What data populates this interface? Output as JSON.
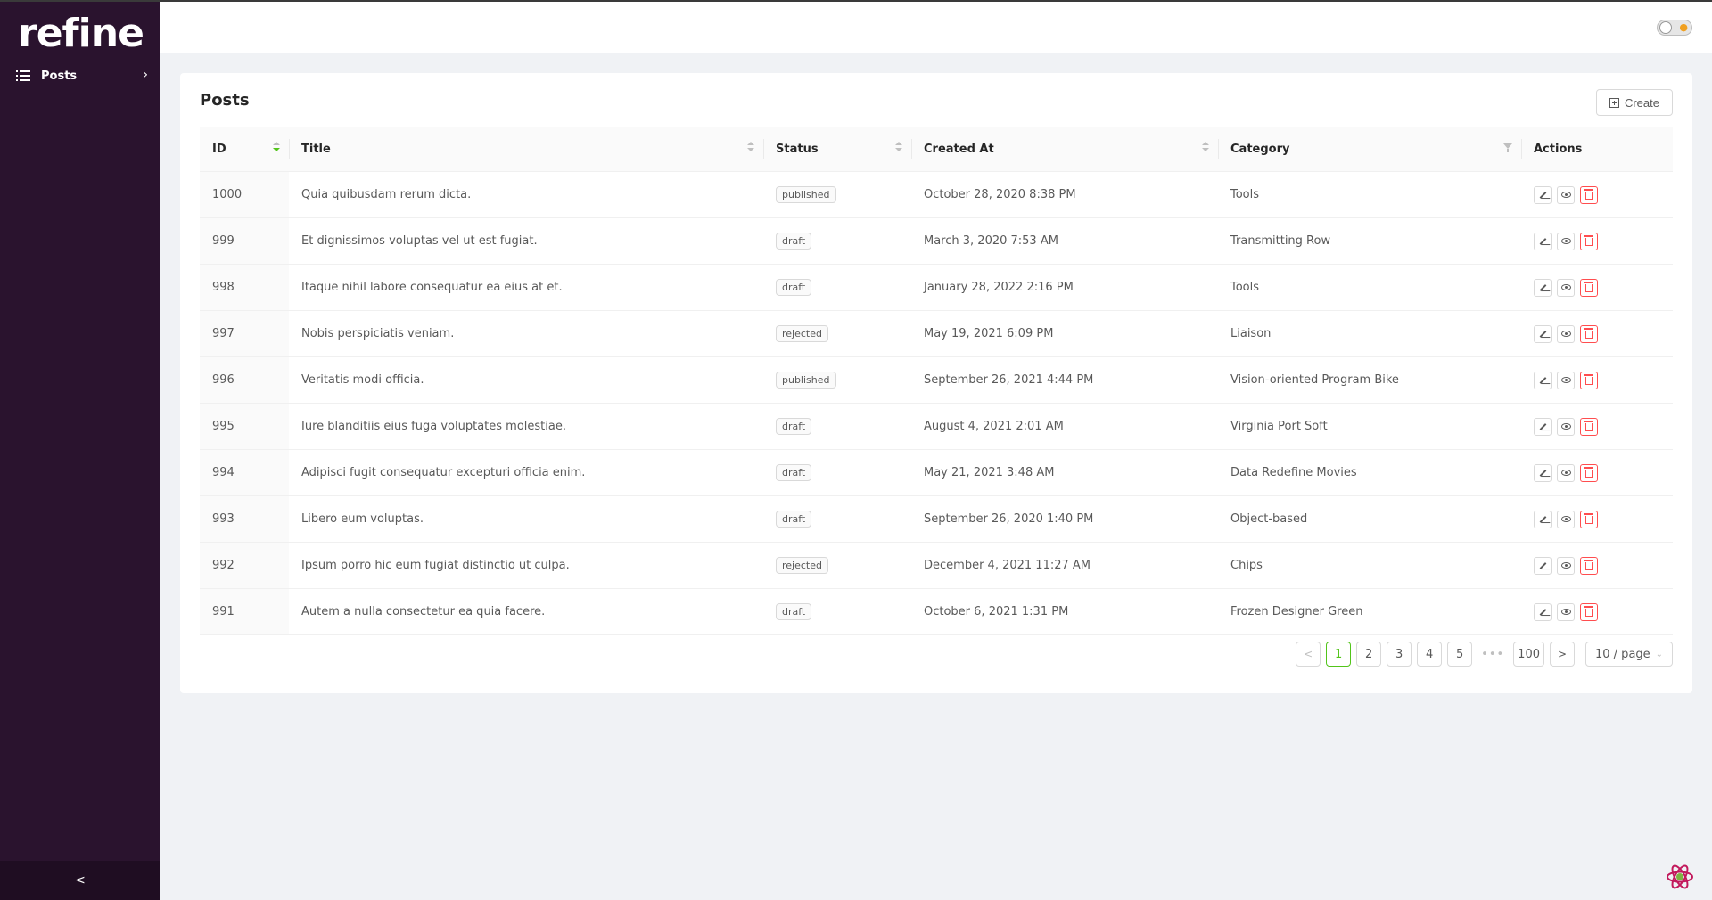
{
  "sidebar": {
    "logo": "refine",
    "items": [
      {
        "label": "Posts"
      }
    ],
    "collapse_label": "<"
  },
  "header": {
    "theme_toggle": "light"
  },
  "page": {
    "title": "Posts",
    "create_label": "Create"
  },
  "table": {
    "columns": [
      "ID",
      "Title",
      "Status",
      "Created At",
      "Category",
      "Actions"
    ],
    "rows": [
      {
        "id": "1000",
        "title": "Quia quibusdam rerum dicta.",
        "status": "published",
        "created_at": "October 28, 2020 8:38 PM",
        "category": "Tools"
      },
      {
        "id": "999",
        "title": "Et dignissimos voluptas vel ut est fugiat.",
        "status": "draft",
        "created_at": "March 3, 2020 7:53 AM",
        "category": "Transmitting Row"
      },
      {
        "id": "998",
        "title": "Itaque nihil labore consequatur ea eius at et.",
        "status": "draft",
        "created_at": "January 28, 2022 2:16 PM",
        "category": "Tools"
      },
      {
        "id": "997",
        "title": "Nobis perspiciatis veniam.",
        "status": "rejected",
        "created_at": "May 19, 2021 6:09 PM",
        "category": "Liaison"
      },
      {
        "id": "996",
        "title": "Veritatis modi officia.",
        "status": "published",
        "created_at": "September 26, 2021 4:44 PM",
        "category": "Vision-oriented Program Bike"
      },
      {
        "id": "995",
        "title": "Iure blanditiis eius fuga voluptates molestiae.",
        "status": "draft",
        "created_at": "August 4, 2021 2:01 AM",
        "category": "Virginia Port Soft"
      },
      {
        "id": "994",
        "title": "Adipisci fugit consequatur excepturi officia enim.",
        "status": "draft",
        "created_at": "May 21, 2021 3:48 AM",
        "category": "Data Redefine Movies"
      },
      {
        "id": "993",
        "title": "Libero eum voluptas.",
        "status": "draft",
        "created_at": "September 26, 2020 1:40 PM",
        "category": "Object-based"
      },
      {
        "id": "992",
        "title": "Ipsum porro hic eum fugiat distinctio ut culpa.",
        "status": "rejected",
        "created_at": "December 4, 2021 11:27 AM",
        "category": "Chips"
      },
      {
        "id": "991",
        "title": "Autem a nulla consectetur ea quia facere.",
        "status": "draft",
        "created_at": "October 6, 2021 1:31 PM",
        "category": "Frozen Designer Green"
      }
    ]
  },
  "pagination": {
    "prev": "<",
    "pages": [
      "1",
      "2",
      "3",
      "4",
      "5"
    ],
    "current": "1",
    "ellipsis": "•••",
    "last": "100",
    "next": ">",
    "page_size": "10 / page"
  },
  "colors": {
    "sidebar_bg": "#2a132e",
    "accent": "#52c41a",
    "danger": "#ff4d4f"
  }
}
